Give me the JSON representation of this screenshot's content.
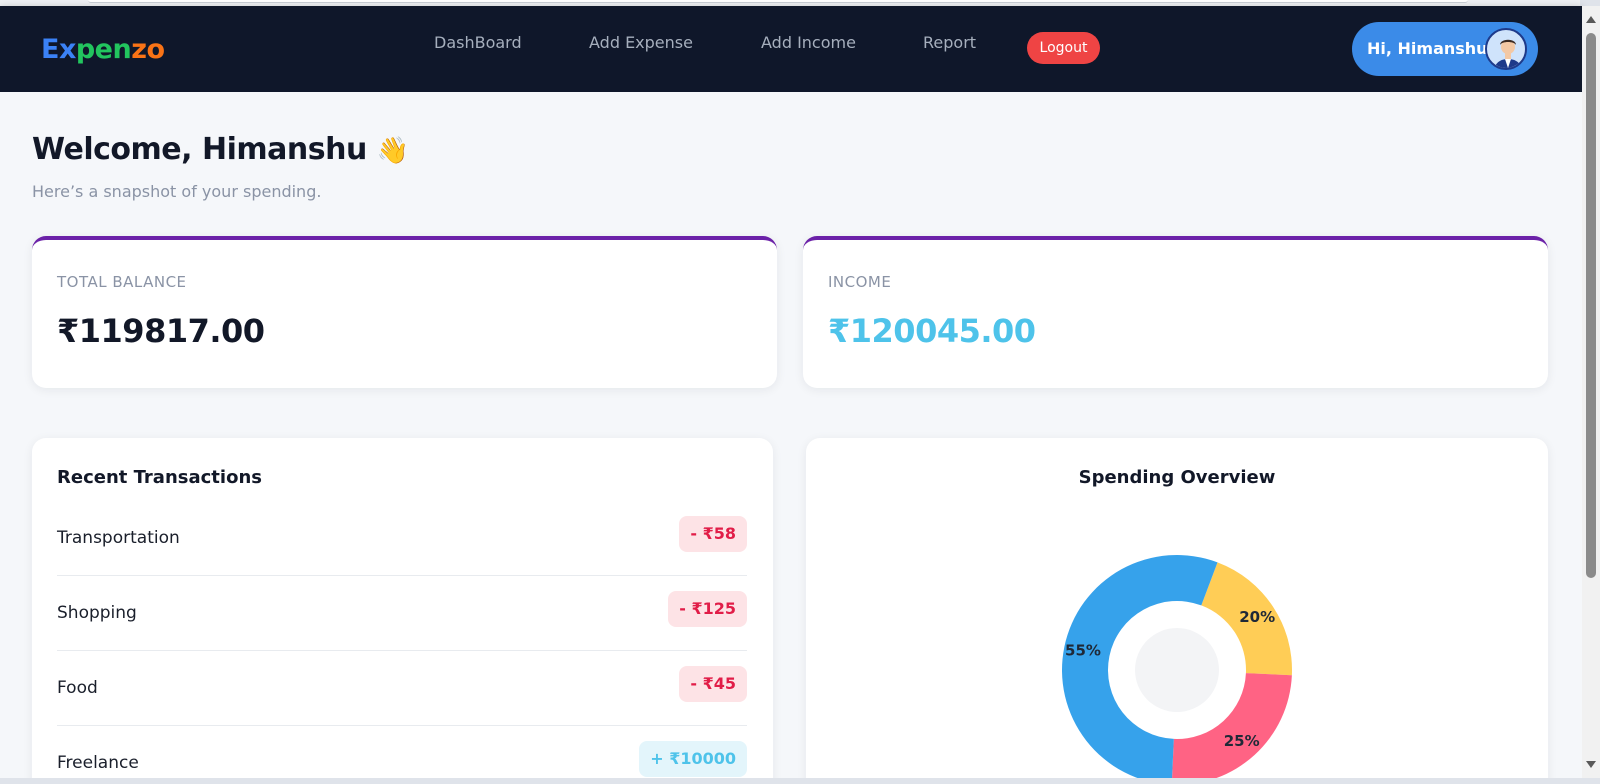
{
  "header": {
    "logo": [
      "Ex",
      "pen",
      "zo"
    ],
    "nav": [
      "DashBoard",
      "Add Expense",
      "Add Income",
      "Report"
    ],
    "logout_label": "Logout",
    "greeting": "Hi, Himanshu"
  },
  "welcome": {
    "title": "Welcome, Himanshu",
    "emoji": "👋",
    "subtitle": "Here’s a snapshot of your spending."
  },
  "stats": {
    "balance": {
      "label": "TOTAL BALANCE",
      "value": "₹119817.00"
    },
    "income": {
      "label": "INCOME",
      "value": "₹120045.00"
    }
  },
  "transactions": {
    "title": "Recent Transactions",
    "items": [
      {
        "name": "Transportation",
        "amount": "- ₹58",
        "type": "expense"
      },
      {
        "name": "Shopping",
        "amount": "- ₹125",
        "type": "expense"
      },
      {
        "name": "Food",
        "amount": "- ₹45",
        "type": "expense"
      },
      {
        "name": "Freelance",
        "amount": "+ ₹10000",
        "type": "income"
      }
    ]
  },
  "overview": {
    "title": "Spending Overview",
    "slice_labels": [
      "20%",
      "25%",
      "55%"
    ]
  },
  "chart_data": {
    "type": "pie",
    "title": "Spending Overview",
    "values": [
      20,
      25,
      55
    ],
    "colors": [
      "#ffcd56",
      "#ff6384",
      "#36a2eb"
    ]
  },
  "colors": {
    "navbar": "#0f172a",
    "accent_purple": "#6b21a8",
    "income_value": "#4ec3ea",
    "logout": "#ef4444",
    "user_pill": "#3b8be8"
  }
}
